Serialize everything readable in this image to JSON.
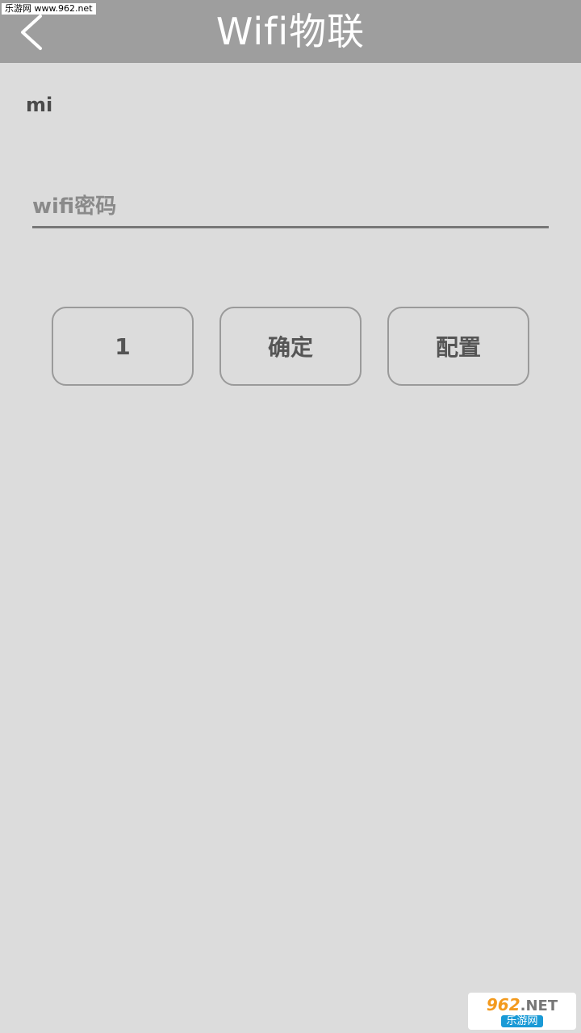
{
  "header": {
    "title": "Wifi物联",
    "back_icon": "chevron-left-icon"
  },
  "watermark_top": "乐游网 www.962.net",
  "wifi": {
    "ssid": "mi",
    "password_placeholder": "wifi密码",
    "password_value": ""
  },
  "buttons": {
    "one_label": "1",
    "confirm_label": "确定",
    "config_label": "配置"
  },
  "watermark_bottom": {
    "logo_num": "962",
    "logo_net": ".NET",
    "sub": "乐游网"
  },
  "colors": {
    "header_bg": "#9e9e9e",
    "page_bg": "#dcdcdc",
    "button_border": "#9a9a9a",
    "text": "#555555"
  }
}
